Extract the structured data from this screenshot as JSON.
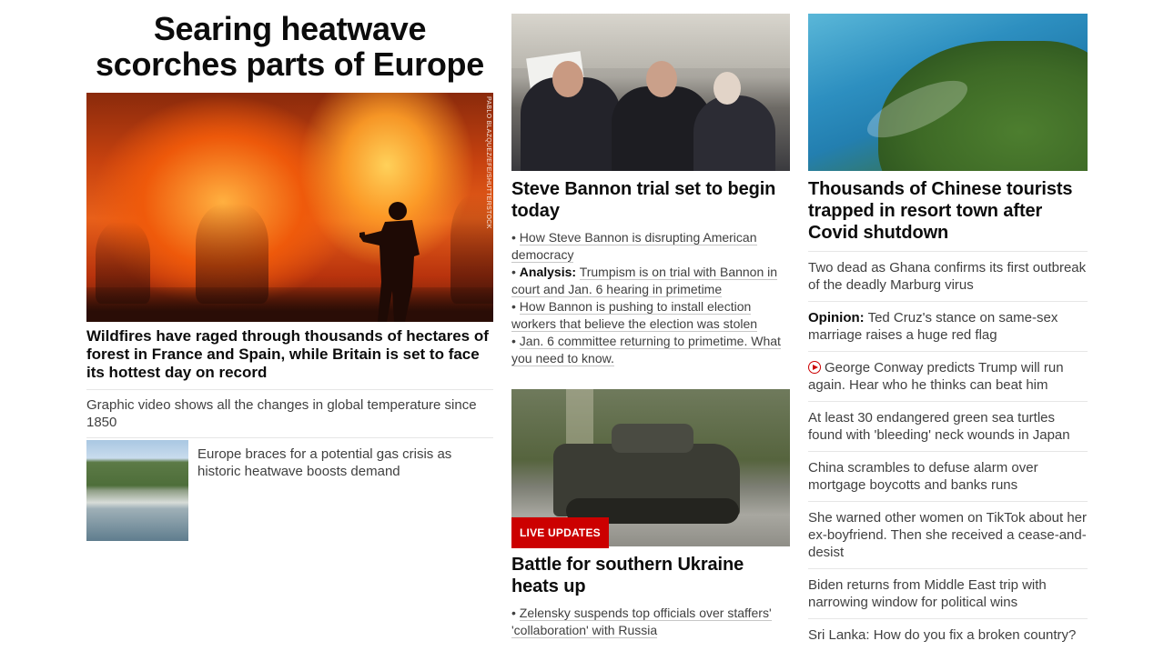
{
  "col1": {
    "headline": "Searing heatwave scorches parts of Europe",
    "image_credit": "PABLO BLAZQUEZ/EFE/SHUTTERSTOCK",
    "caption": "Wildfires have raged through thousands of hectares of forest in France and Spain, while Britain is set to face its hottest day on record",
    "item1": "Graphic video shows all the changes in global temperature since 1850",
    "thumb_text": "Europe braces for a potential gas crisis as historic heatwave boosts demand"
  },
  "col2": {
    "story1": {
      "headline": "Steve Bannon trial set to begin today",
      "bullets": [
        {
          "prefix": "",
          "text": "How Steve Bannon is disrupting American democracy"
        },
        {
          "prefix": "Analysis:",
          "text": "Trumpism is on trial with Bannon in court and Jan. 6 hearing in primetime"
        },
        {
          "prefix": "",
          "text": "How Bannon is pushing to install election workers that believe the election was stolen"
        },
        {
          "prefix": "",
          "text": "Jan. 6 committee returning to primetime. What you need to know."
        }
      ]
    },
    "story2": {
      "badge": "LIVE UPDATES",
      "headline": "Battle for southern Ukraine heats up",
      "bullets": [
        {
          "prefix": "",
          "text": "Zelensky suspends top officials over staffers' 'collaboration' with Russia"
        }
      ]
    }
  },
  "col3": {
    "headline": "Thousands of Chinese tourists trapped in resort town after Covid shutdown",
    "items": [
      {
        "prefix": "",
        "text": "Two dead as Ghana confirms its first outbreak of the deadly Marburg virus",
        "video": false
      },
      {
        "prefix": "Opinion:",
        "text": "Ted Cruz's stance on same-sex marriage raises a huge red flag",
        "video": false
      },
      {
        "prefix": "",
        "text": "George Conway predicts Trump will run again. Hear who he thinks can beat him",
        "video": true
      },
      {
        "prefix": "",
        "text": "At least 30 endangered green sea turtles found with 'bleeding' neck wounds in Japan",
        "video": false
      },
      {
        "prefix": "",
        "text": "China scrambles to defuse alarm over mortgage boycotts and banks runs",
        "video": false
      },
      {
        "prefix": "",
        "text": "She warned other women on TikTok about her ex-boyfriend. Then she received a cease-and-desist",
        "video": false
      },
      {
        "prefix": "",
        "text": "Biden returns from Middle East trip with narrowing window for political wins",
        "video": false
      },
      {
        "prefix": "",
        "text": "Sri Lanka: How do you fix a broken country?",
        "video": false
      }
    ]
  },
  "colors": {
    "accent_red": "#cc0000",
    "text": "#0c0c0c",
    "secondary": "#404040"
  }
}
